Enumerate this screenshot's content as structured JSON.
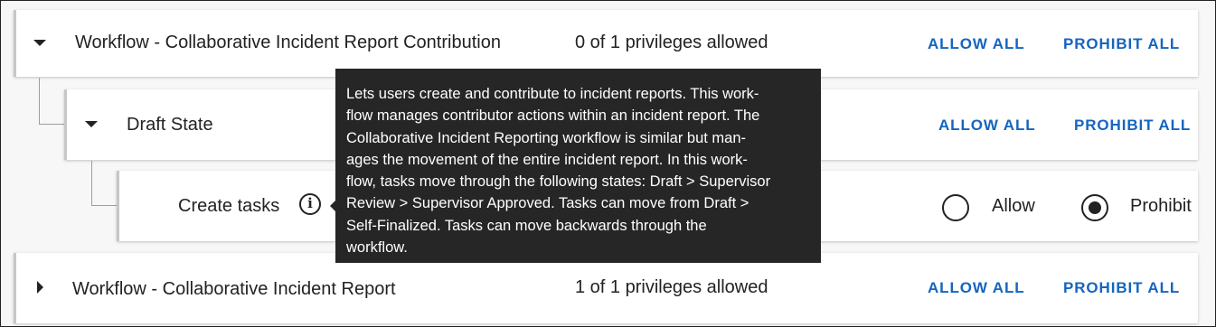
{
  "rows": {
    "workflow1": {
      "title": "Workflow - Collaborative Incident Report Contribution",
      "count": "0 of 1 privileges allowed",
      "allow_all": "ALLOW ALL",
      "prohibit_all": "PROHIBIT ALL"
    },
    "draft_state": {
      "title": "Draft State",
      "allow_all": "ALLOW ALL",
      "prohibit_all": "PROHIBIT ALL"
    },
    "create_tasks": {
      "title": "Create tasks",
      "info_icon": "info-icon",
      "allow_label": "Allow",
      "prohibit_label": "Prohibit",
      "selected": "Prohibit"
    },
    "workflow2": {
      "title": "Workflow - Collaborative Incident Report",
      "count": "1 of 1 privileges allowed",
      "allow_all": "ALLOW ALL",
      "prohibit_all": "PROHIBIT ALL"
    }
  },
  "tooltip": {
    "lines": [
      "Lets users create and contribute to incident reports. This work-",
      "flow manages contributor actions within an incident report. The",
      "Collaborative Incident Reporting workflow is similar but man-",
      "ages the movement of the entire incident report. In this work-",
      "flow, tasks move through the following states: Draft > Supervisor",
      "Review > Supervisor Approved. Tasks can move from Draft >",
      "Self-Finalized. Tasks can move backwards through the",
      "workflow."
    ]
  },
  "colors": {
    "accent_blue": "#1565c0",
    "tooltip_bg": "#262626"
  }
}
